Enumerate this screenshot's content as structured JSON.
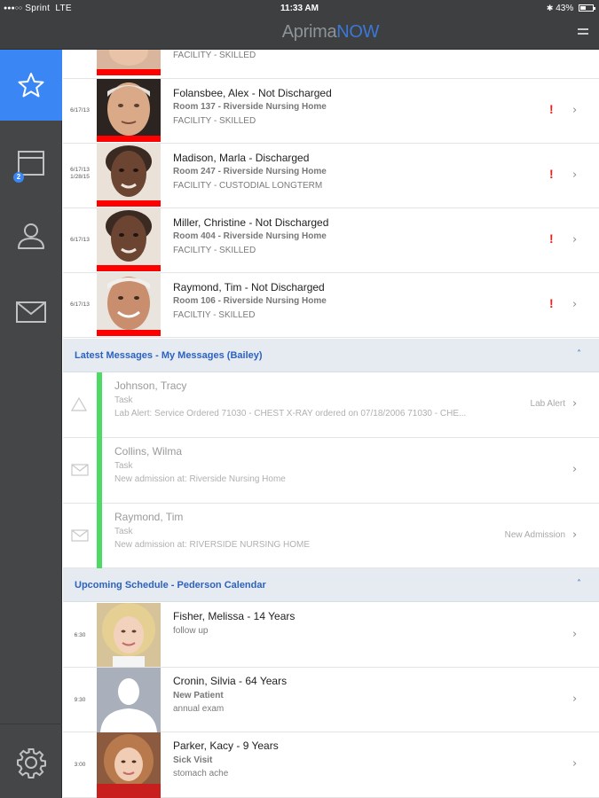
{
  "status": {
    "carrier": "Sprint",
    "network": "LTE",
    "time": "11:33 AM",
    "battery": "43%",
    "battery_level": 0.43
  },
  "header": {
    "logo_part1": "Aprima",
    "logo_part2": "NOW",
    "menu_icon": "menu-icon"
  },
  "sidebar": {
    "items": [
      {
        "icon": "star-icon",
        "active": true
      },
      {
        "icon": "calendar-icon",
        "badge": "2"
      },
      {
        "icon": "person-icon"
      },
      {
        "icon": "mail-icon"
      },
      {
        "icon": "gear-icon"
      }
    ]
  },
  "patients": {
    "partial": {
      "line3": "FACILITY - SKILLED"
    },
    "items": [
      {
        "date": "6/17/13",
        "name": "Folansbee, Alex - Not Discharged",
        "line2": "Room 137 - Riverside Nursing Home",
        "line3": "FACILITY - SKILLED",
        "alert": "!"
      },
      {
        "date": "6/17/13",
        "date2": "1/28/15",
        "name": "Madison, Marla - Discharged",
        "line2": "Room 247 - Riverside Nursing Home",
        "line3": "FACILITY - CUSTODIAL LONGTERM",
        "alert": "!"
      },
      {
        "date": "6/17/13",
        "name": "Miller, Christine - Not Discharged",
        "line2": "Room 404 - Riverside Nursing Home",
        "line3": "FACILITY - SKILLED",
        "alert": "!"
      },
      {
        "date": "6/17/13",
        "name": "Raymond, Tim - Not Discharged",
        "line2": "Room 106 - Riverside Nursing Home",
        "line3": "FACILTIY - SKILLED",
        "alert": "!"
      }
    ]
  },
  "messages": {
    "header": "Latest Messages - My Messages (Bailey)",
    "items": [
      {
        "icon": "alert-triangle-icon",
        "name": "Johnson, Tracy",
        "type": "Task",
        "text": "Lab Alert: Service Ordered 71030 - CHEST X-RAY ordered on 07/18/2006 71030 - CHE...",
        "tag": "Lab Alert"
      },
      {
        "icon": "envelope-icon",
        "name": "Collins, Wilma",
        "type": "Task",
        "text": "New admission at: Riverside Nursing Home",
        "tag": ""
      },
      {
        "icon": "envelope-icon",
        "name": "Raymond, Tim",
        "type": "Task",
        "text": "New admission at: RIVERSIDE NURSING HOME",
        "tag": "New Admission"
      }
    ]
  },
  "schedule": {
    "header": "Upcoming Schedule - Pederson Calendar",
    "items": [
      {
        "time": "6:30",
        "name": "Fisher, Melissa - 14 Years",
        "line2": "follow up",
        "line3": ""
      },
      {
        "time": "9:30",
        "name": "Cronin, Silvia - 64 Years",
        "line2": "New Patient",
        "line3": "annual exam"
      },
      {
        "time": "3:00",
        "name": "Parker, Kacy - 9 Years",
        "line2": "Sick Visit",
        "line3": "stomach ache"
      }
    ]
  },
  "colors": {
    "accent": "#3a86f5",
    "sidebar": "#444648",
    "alert_red": "#ff0000",
    "message_green": "#4cd964",
    "section_bg": "#e6ebf2"
  }
}
